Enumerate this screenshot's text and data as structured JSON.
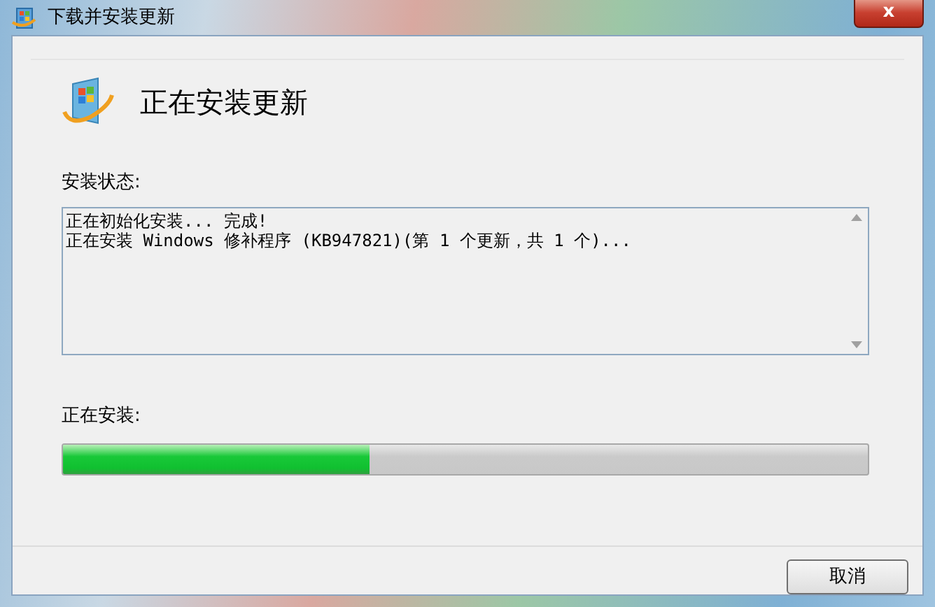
{
  "window": {
    "title": "下载并安装更新",
    "close_label": "x"
  },
  "header": {
    "title": "正在安装更新"
  },
  "status": {
    "label": "安装状态:",
    "lines": [
      "正在初始化安装... 完成!",
      "正在安装 Windows 修补程序 (KB947821)(第 1 个更新，共 1 个)..."
    ]
  },
  "progress": {
    "label": "正在安装:",
    "level": 0.38
  },
  "buttons": [
    "取消"
  ]
}
